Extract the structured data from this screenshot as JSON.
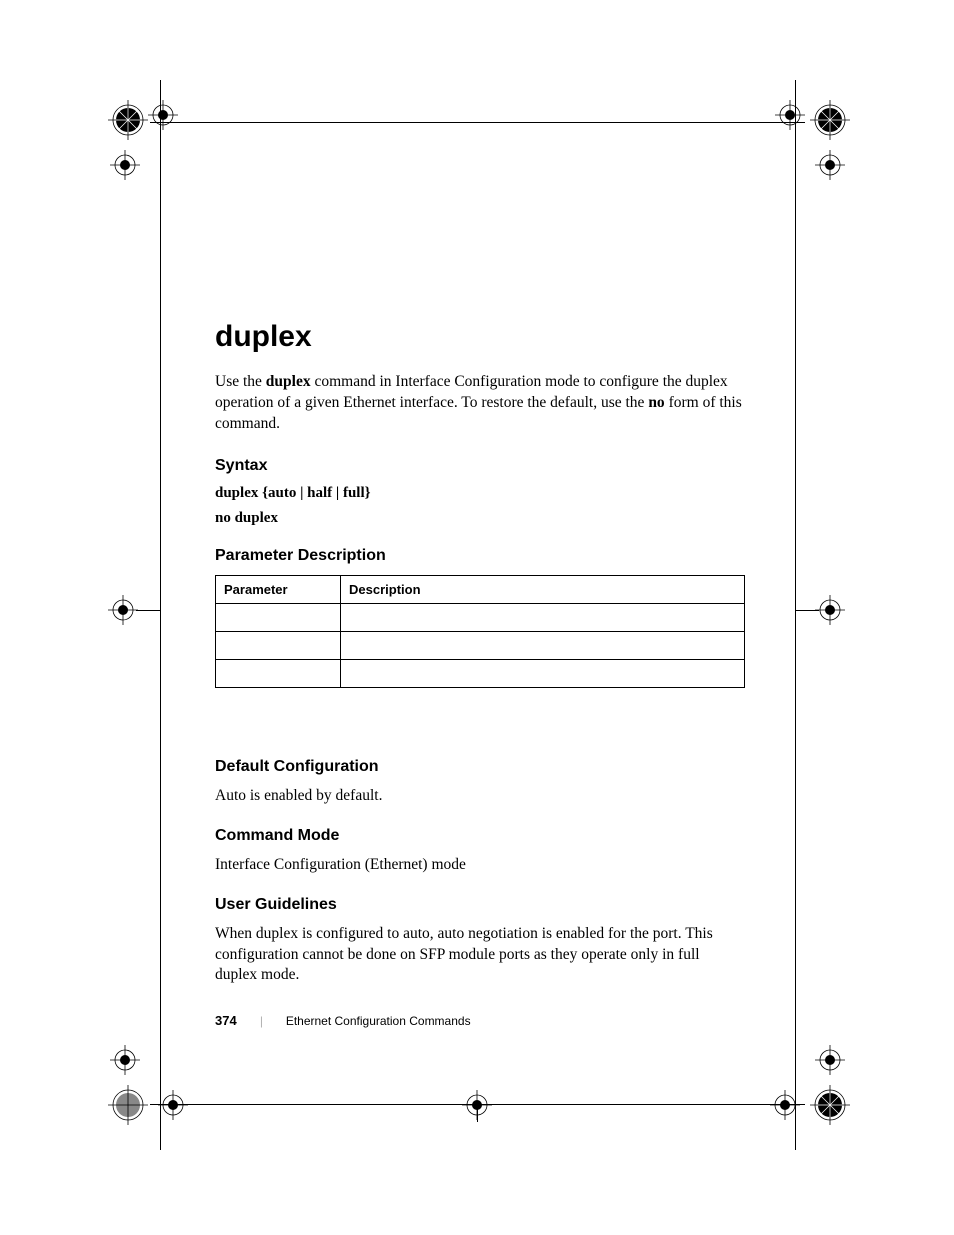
{
  "title": "duplex",
  "intro_parts": {
    "p1": "Use the ",
    "b1": "duplex",
    "p2": " command in Interface Configuration mode to configure the duplex operation of a given Ethernet interface. To restore the default, use the ",
    "b2": "no",
    "p3": " form of this command."
  },
  "syntax": {
    "heading": "Syntax",
    "line1": "duplex {auto | half | full}",
    "line2": "no duplex"
  },
  "param_desc": {
    "heading": "Parameter Description",
    "col1": "Parameter",
    "col2": "Description",
    "rows": [
      {
        "param": "",
        "desc": ""
      },
      {
        "param": "",
        "desc": ""
      },
      {
        "param": "",
        "desc": ""
      }
    ]
  },
  "default_config": {
    "heading": "Default Configuration",
    "text": "Auto is enabled by default."
  },
  "command_mode": {
    "heading": "Command Mode",
    "text": "Interface Configuration (Ethernet) mode"
  },
  "user_guidelines": {
    "heading": "User Guidelines",
    "text": "When duplex is configured to auto, auto negotiation is enabled for the port. This configuration cannot be done on SFP module ports as they operate only in full duplex mode."
  },
  "footer": {
    "pagenum": "374",
    "chapter": "Ethernet Configuration Commands"
  }
}
